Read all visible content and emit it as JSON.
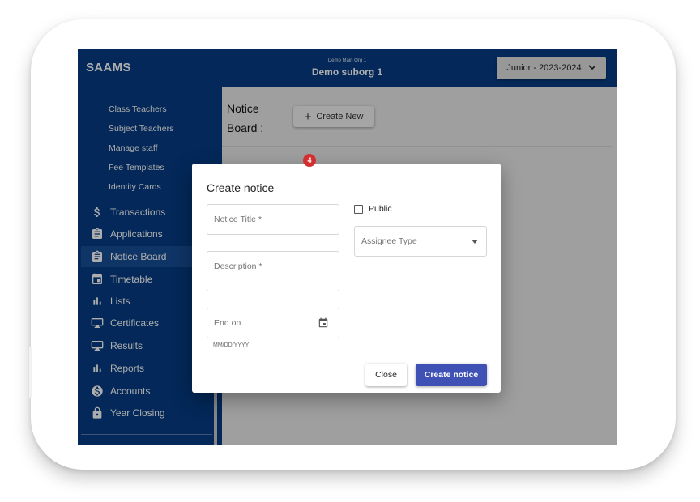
{
  "header": {
    "brand": "SAAMS",
    "org_main": "Demo Main Org 1",
    "org_sub": "Demo suborg 1",
    "session": "Junior - 2023-2024"
  },
  "sidebar": {
    "sub_items": [
      {
        "label": "Class Teachers"
      },
      {
        "label": "Subject Teachers"
      },
      {
        "label": "Manage staff"
      },
      {
        "label": "Fee Templates"
      },
      {
        "label": "Identity Cards"
      }
    ],
    "items": [
      {
        "label": "Transactions",
        "icon": "dollar-icon"
      },
      {
        "label": "Applications",
        "icon": "clipboard-icon"
      },
      {
        "label": "Notice Board",
        "icon": "clipboard-icon",
        "active": true
      },
      {
        "label": "Timetable",
        "icon": "calendar-icon"
      },
      {
        "label": "Lists",
        "icon": "bar-chart-icon"
      },
      {
        "label": "Certificates",
        "icon": "certificate-icon"
      },
      {
        "label": "Results",
        "icon": "certificate-icon"
      },
      {
        "label": "Reports",
        "icon": "bar-chart-icon"
      },
      {
        "label": "Accounts",
        "icon": "dollar-circle-icon"
      },
      {
        "label": "Year Closing",
        "icon": "lock-icon"
      }
    ]
  },
  "main": {
    "title": "Notice Board :",
    "create_new": "Create New",
    "tab_badge": "4"
  },
  "modal": {
    "title": "Create notice",
    "notice_title_placeholder": "Notice Title *",
    "description_placeholder": "Description *",
    "end_on_placeholder": "End on",
    "date_format_hint": "MM/DD/YYYY",
    "public_label": "Public",
    "assignee_type_placeholder": "Assignee Type",
    "close_label": "Close",
    "create_label": "Create notice"
  },
  "colors": {
    "navy": "#053c83",
    "primary_button": "#3f51b5",
    "badge": "#d32f2f"
  }
}
